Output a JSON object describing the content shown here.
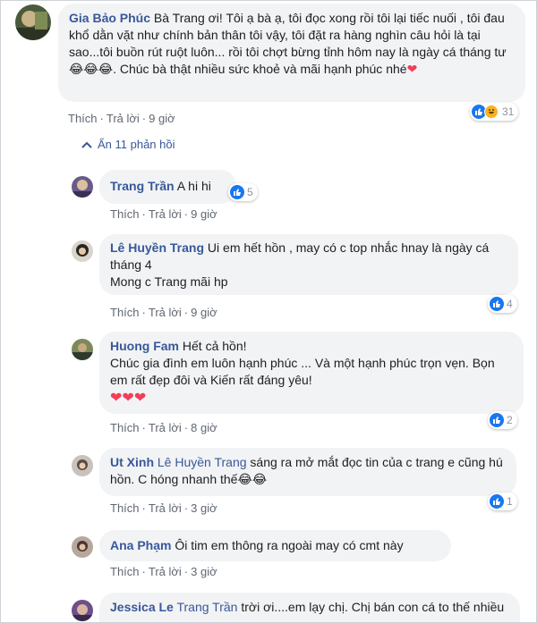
{
  "main_comment": {
    "author": "Gia Bảo Phúc",
    "text": "Bà Trang ơi! Tôi ạ bà ạ, tôi đọc xong rồi tôi lại tiếc nuối , tôi đau khổ dằn vặt như chính bản thân tôi vậy, tôi đặt ra hàng nghìn câu hỏi là tại sao...tôi buồn rút ruột luôn... rồi tôi chợt bừng tỉnh hôm nay là ngày cá tháng tư",
    "emoji": "😂😂😂",
    "text2": ". Chúc bà thật nhiều sức khoẻ và mãi hạnh phúc nhé",
    "like": "Thích",
    "reply": "Trả lời",
    "time": "9 giờ",
    "reactions": "31"
  },
  "replies_toggle": "Ẩn 11 phản hồi",
  "replies": [
    {
      "author": "Trang Trần",
      "text": "A hi hi",
      "like": "Thích",
      "reply": "Trả lời",
      "time": "9 giờ",
      "reactions": "5"
    },
    {
      "author": "Lê Huyền Trang",
      "line1": "Ui em hết hồn , may có c top nhắc hnay là ngày cá tháng 4",
      "line2": "Mong c Trang mãi hp",
      "like": "Thích",
      "reply": "Trả lời",
      "time": "9 giờ",
      "reactions": "4"
    },
    {
      "author": "Huong Fam",
      "line1": "Hết cả hồn!",
      "line2": "Chúc gia đình em luôn hạnh phúc ... Và một hạnh phúc trọn vẹn. Bọn em rất đẹp đôi và Kiến rất đáng yêu!",
      "hearts": "❤❤❤",
      "like": "Thích",
      "reply": "Trả lời",
      "time": "8 giờ",
      "reactions": "2"
    },
    {
      "author": "Ut Xinh",
      "mention": "Lê Huyền Trang",
      "text": "sáng ra mở mắt đọc tin của c trang e cũng hú hồn. C hóng nhanh thế",
      "emoji": "😂😂",
      "like": "Thích",
      "reply": "Trả lời",
      "time": "3 giờ",
      "reactions": "1"
    },
    {
      "author": "Ana Phạm",
      "text": "Ôi tim em thông ra ngoài may có cmt này",
      "like": "Thích",
      "reply": "Trả lời",
      "time": "3 giờ"
    },
    {
      "author": "Jessica Le",
      "mention": "Trang Trần",
      "text": "trời ơi....em lạy chị. Chị bán con cá to thế nhiều"
    }
  ],
  "colors": {
    "link": "#385898",
    "bubble": "#f2f3f5",
    "like": "#1877f2",
    "heart": "#f33e58"
  }
}
